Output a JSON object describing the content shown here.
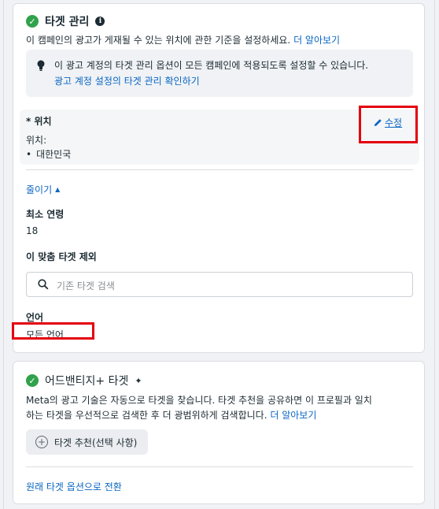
{
  "targeting": {
    "title": "타겟 관리",
    "description": "이 캠페인의 광고가 게재될 수 있는 위치에 관한 기준을 설정하세요.",
    "learn_more": "더 알아보기",
    "notice_text": "이 광고 계정의 타겟 관리 옵션이 모든 캠페인에 적용되도록 설정할 수 있습니다.",
    "notice_link": "광고 계정 설정의 타겟 관리 확인하기",
    "location_label": "* 위치",
    "edit_label": "수정",
    "location_sub": "위치:",
    "location_value": "대한민국",
    "collapse_label": "줄이기",
    "min_age_label": "최소 연령",
    "min_age_value": "18",
    "exclude_label": "이 맞춤 타겟 제외",
    "search_placeholder": "기존 타겟 검색",
    "language_label": "언어",
    "language_value": "모든 언어"
  },
  "advantage": {
    "title": "어드밴티지+ 타겟",
    "description_line1": "Meta의 광고 기술은 자동으로 타겟을 찾습니다. 타겟 추천을 공유하면 이 프로필과 일치",
    "description_line2": "하는 타겟을 우선적으로 검색한 후 더 광범위하게 검색합니다.",
    "learn_more": "더 알아보기",
    "suggest_button": "타겟 추천(선택 사항)",
    "switch_link": "원래 타겟 옵션으로 전환"
  },
  "colors": {
    "link": "#0a66c2",
    "success": "#31a24c",
    "highlight": "#e4000e"
  }
}
